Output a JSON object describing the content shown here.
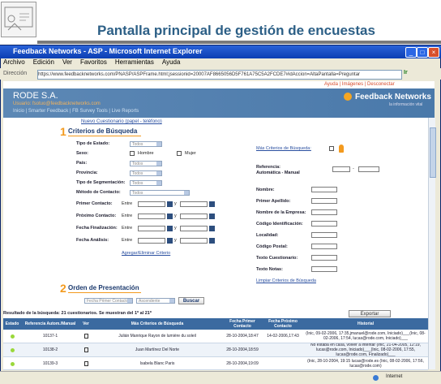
{
  "slide": {
    "title": "Pantalla principal de gestión de encuestas"
  },
  "window": {
    "title": "Feedback Networks - ASP - Microsoft Internet Explorer"
  },
  "menu": [
    "Archivo",
    "Edición",
    "Ver",
    "Favoritos",
    "Herramientas",
    "Ayuda"
  ],
  "address": {
    "label": "Dirección",
    "url": "https://www.feedbacknetworks.com/PNASP/ASPFrame.html;jsessionid=20007AF8665056D5F761A75C5A2FCDE7#idAccion=AltaPantalla=Preguntar",
    "go": "Ir"
  },
  "banner": {
    "toplinks": "Ayuda | Imágenes | Desconectar",
    "company": "RODE S.A.",
    "email": "Usuario: fsotuo@feedbacknetworks.com",
    "nav": "Inicio | Smarter Feedback | FB Survey Tools | Live Reports",
    "brand": "Feedback Networks",
    "brand_sub": "la información vital"
  },
  "link_nuevo": "Nuevo Cuestionario (papel - teléfono)",
  "sec1": {
    "num": "1",
    "title": "Criterios de Búsqueda"
  },
  "sec2": {
    "num": "2",
    "title": "Orden de Presentación"
  },
  "fields": {
    "tipo_estado": "Tipo de Estado:",
    "sexo": "Sexo:",
    "hombre": "Hombre",
    "mujer": "Mujer",
    "pais": "País:",
    "provincia": "Provincia:",
    "tipo_seg": "Tipo de Segmentación:",
    "metodo": "Método de Contacto:",
    "primer": "Primer Contacto:",
    "proximo": "Próximo Contacto:",
    "finalizacion": "Fecha Finalización:",
    "analisis": "Fecha Análisis:",
    "entre": "Entre",
    "y": "y",
    "todos": "Todos",
    "agregar": "Agregar/Eliminar Criterio",
    "mas_criterios": "Más Criterios de Búsqueda:",
    "referencia": "Referencia:",
    "automatica": "Automática - Manual",
    "nombre": "Nombre:",
    "apellido": "Primer Apellido:",
    "empresa": "Nombre de la Empresa:",
    "codigo": "Código Identificación:",
    "localidad": "Localidad:",
    "postal": "Código Postal:",
    "texto_cuest": "Texto Cuestionario:",
    "texto_notas": "Texto Notas:",
    "limpiar": "Limpiar Criterios de Búsqueda"
  },
  "order": {
    "field": "Fecha Primer Contacto",
    "dir": "Ascendente",
    "buscar": "Buscar"
  },
  "results": {
    "label": "Resultado de la búsqueda: 21 cuestionarios. Se muestran del 1º al 21º",
    "export": "Exportar",
    "headers": [
      "Estado",
      "Referencia Autom./Manual",
      "Ver",
      "Más Criterios de Búsqueda",
      "Fecha Primer Contacto",
      "Fecha Próximo Contacto",
      "Historial"
    ],
    "rows": [
      {
        "ref": "10137-1",
        "name": "Julián Manrique Rayon de lumière du soleil",
        "first": "28-10-2004,18:47",
        "next": "14-02-2006,17:43",
        "hist": "(Inic, 09-02-2006, 17:35,jmanuel@rode.com, Iniciado)___(Inic, 08-02-2006, 17:54, lucas@rode.com, Iniciado)___"
      },
      {
        "ref": "10138-2",
        "name": "Juan Martínez Del Norte",
        "first": "28-10-2004,18:59",
        "next": "",
        "hist": "No estaba en casa, volver a intentar (Inic, 21-04-2005, 12:19, lucas@rode.com, Iniciado)___(Inic, 08-02-2006, 17:55, lucas@rode.com, Finalizado)___"
      },
      {
        "ref": "10139-3",
        "name": "Isabela Blanc Paris",
        "first": "28-10-2004,19:09",
        "next": "",
        "hist": "(Inic, 28-10-2004, 19:15 lucas@rode.es (Inic, 08-02-2006, 17:56, lucas@rode.com)"
      }
    ]
  },
  "status": {
    "zone": "Internet"
  },
  "colors": {
    "accent": "#f39a1e",
    "banner": "#4a79aa",
    "table_header": "#3b6aa0"
  }
}
